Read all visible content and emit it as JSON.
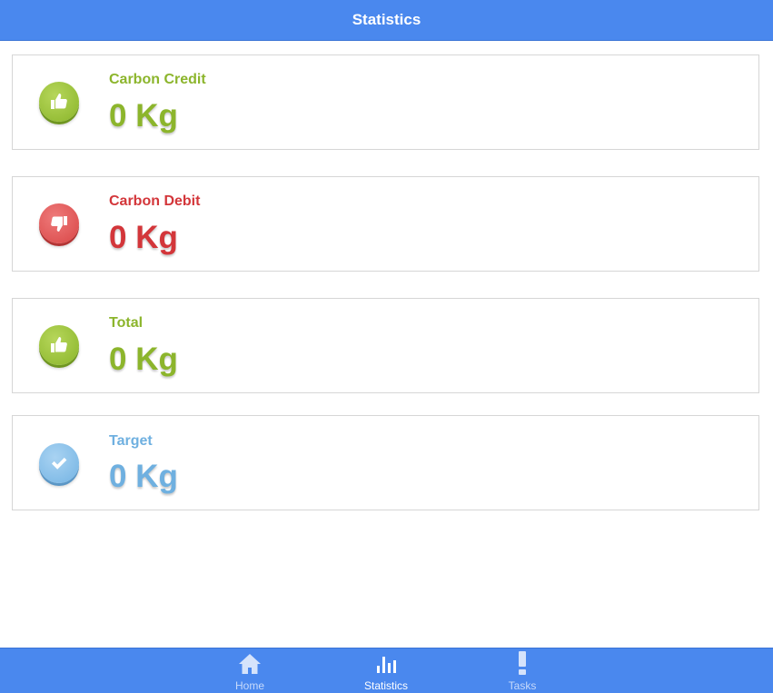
{
  "header": {
    "title": "Statistics"
  },
  "cards": [
    {
      "label": "Carbon Credit",
      "value": "0 Kg",
      "icon": "thumbs-up-icon",
      "color": "#8cb52c"
    },
    {
      "label": "Carbon Debit",
      "value": "0 Kg",
      "icon": "thumbs-down-icon",
      "color": "#d3363a"
    },
    {
      "label": "Total",
      "value": "0 Kg",
      "icon": "thumbs-up-icon",
      "color": "#8cb52c"
    },
    {
      "label": "Target",
      "value": "0 Kg",
      "icon": "checkmark-icon",
      "color": "#6fb0e0"
    }
  ],
  "tabbar": {
    "items": [
      {
        "label": "Home",
        "icon": "home-icon",
        "active": false
      },
      {
        "label": "Statistics",
        "icon": "bar-chart-icon",
        "active": true
      },
      {
        "label": "Tasks",
        "icon": "exclamation-icon",
        "active": false
      }
    ]
  },
  "colors": {
    "accent": "#4a88ee"
  }
}
